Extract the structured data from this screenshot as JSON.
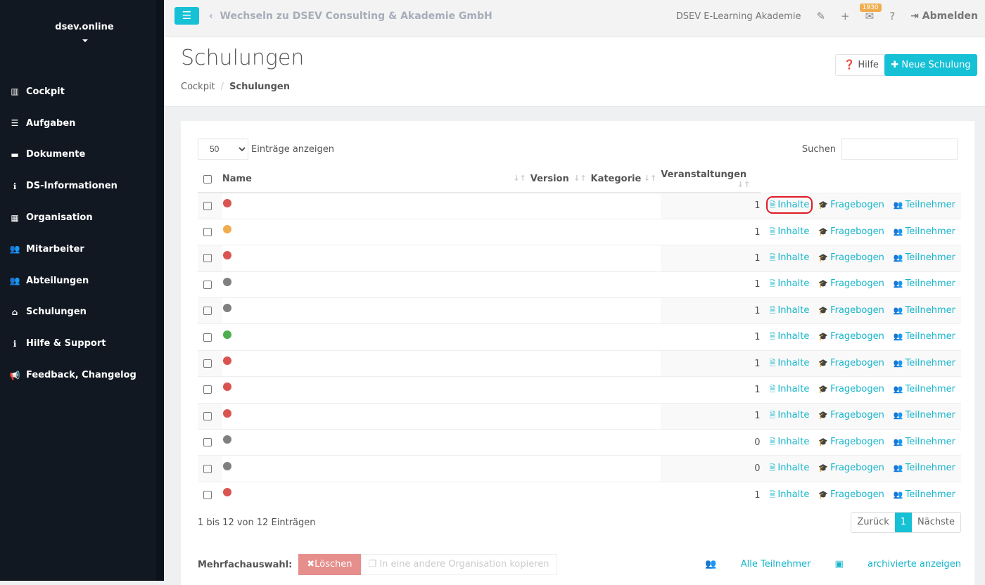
{
  "sidebar": {
    "brand": "dsev.online",
    "items": [
      {
        "label": "Cockpit",
        "icon": "chart-icon"
      },
      {
        "label": "Aufgaben",
        "icon": "list-icon"
      },
      {
        "label": "Dokumente",
        "icon": "folder-icon"
      },
      {
        "label": "DS-Informationen",
        "icon": "info-icon"
      },
      {
        "label": "Organisation",
        "icon": "building-icon"
      },
      {
        "label": "Mitarbeiter",
        "icon": "users-icon"
      },
      {
        "label": "Abteilungen",
        "icon": "users-icon"
      },
      {
        "label": "Schulungen",
        "icon": "school-icon"
      },
      {
        "label": "Hilfe & Support",
        "icon": "info-icon"
      },
      {
        "label": "Feedback, Changelog",
        "icon": "megaphone-icon"
      }
    ]
  },
  "topbar": {
    "switch": "Wechseln zu DSEV Consulting & Akademie GmbH",
    "org": "DSEV E-Learning Akademie",
    "badge": "1930",
    "logout": "Abmelden"
  },
  "header": {
    "title": "Schulungen",
    "breadcrumb": [
      "Cockpit",
      "Schulungen"
    ],
    "help": "Hilfe",
    "new": "Neue Schulung"
  },
  "table": {
    "length": "50",
    "length_label": "Einträge anzeigen",
    "search_label": "Suchen",
    "columns": [
      "Name",
      "Version",
      "Kategorie",
      "Veranstaltungen"
    ],
    "actions": [
      "Inhalte",
      "Fragebogen",
      "Teilnehmer"
    ],
    "rows": [
      {
        "status": "#d9534f",
        "count": "1"
      },
      {
        "status": "#f0ad4e",
        "count": "1"
      },
      {
        "status": "#d9534f",
        "count": "1"
      },
      {
        "status": "#808080",
        "count": "1"
      },
      {
        "status": "#808080",
        "count": "1"
      },
      {
        "status": "#4cae4c",
        "count": "1"
      },
      {
        "status": "#d9534f",
        "count": "1"
      },
      {
        "status": "#d9534f",
        "count": "1"
      },
      {
        "status": "#d9534f",
        "count": "1"
      },
      {
        "status": "#808080",
        "count": "0"
      },
      {
        "status": "#808080",
        "count": "0"
      },
      {
        "status": "#d9534f",
        "count": "1"
      }
    ],
    "info": "1 bis 12 von 12 Einträgen",
    "prev": "Zurück",
    "page": "1",
    "next": "Nächste"
  },
  "footer": {
    "multi": "Mehrfachauswahl:",
    "delete": "Löschen",
    "copy": "In eine andere Organisation kopieren",
    "all": "Alle Teilnehmer",
    "archived": "archivierte anzeigen"
  }
}
